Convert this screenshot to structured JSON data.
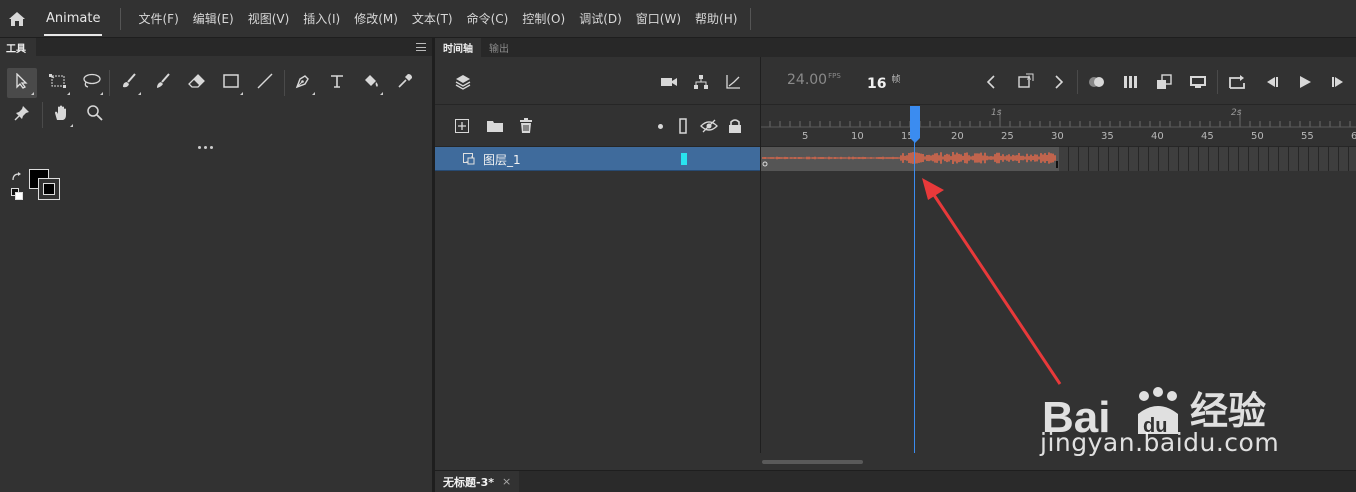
{
  "menubar": {
    "app_name": "Animate",
    "items": [
      "文件(F)",
      "编辑(E)",
      "视图(V)",
      "插入(I)",
      "修改(M)",
      "文本(T)",
      "命令(C)",
      "控制(O)",
      "调试(D)",
      "窗口(W)",
      "帮助(H)"
    ]
  },
  "tools_panel": {
    "title": "工具",
    "more_label": "...",
    "icons": [
      "selection-arrow-icon",
      "free-transform-icon",
      "lasso-icon",
      "paint-brush-icon",
      "brush-icon",
      "eraser-icon",
      "rectangle-icon",
      "line-icon",
      "pen-icon",
      "text-tool-icon",
      "paint-bucket-icon",
      "eyedropper-icon",
      "pin-icon",
      "hand-icon",
      "zoom-icon"
    ]
  },
  "timeline": {
    "tabs": [
      "时间轴",
      "输出"
    ],
    "fps_value": "24.00",
    "fps_unit": "FPS",
    "current_frame": "16",
    "frame_unit": "帧",
    "ruler_numbers": [
      "5",
      "10",
      "15",
      "20",
      "25",
      "30",
      "35",
      "40",
      "45",
      "50",
      "55",
      "6"
    ],
    "seconds": [
      "1s",
      "2s"
    ],
    "current_frame_index": 16,
    "sound_end_frame": 30,
    "layer": {
      "name": "图层_1",
      "color": "#29e3ef"
    }
  },
  "document_tab": {
    "title": "无标题-3*",
    "close": "×"
  },
  "watermark": {
    "brand": "Bai du 经验",
    "url": "jingyan.baidu.com"
  },
  "colors": {
    "accent": "#3b8cf0",
    "waveform": "#e46a4b",
    "layer_selected": "#3f6b9c",
    "annotation_arrow": "#e8393a"
  }
}
